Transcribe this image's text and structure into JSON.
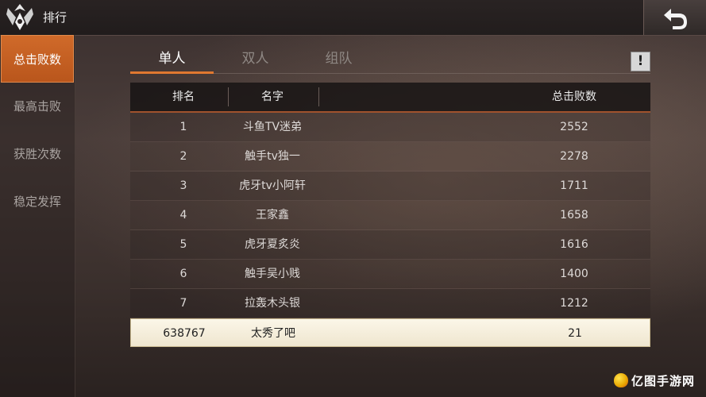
{
  "header": {
    "title": "排行"
  },
  "sidebar": {
    "items": [
      {
        "label": "总击败数",
        "active": true
      },
      {
        "label": "最高击败",
        "active": false
      },
      {
        "label": "获胜次数",
        "active": false
      },
      {
        "label": "稳定发挥",
        "active": false
      }
    ]
  },
  "tabs": [
    {
      "label": "单人",
      "active": true
    },
    {
      "label": "双人",
      "active": false
    },
    {
      "label": "组队",
      "active": false
    }
  ],
  "info_button": {
    "label": "!"
  },
  "table": {
    "headers": {
      "rank": "排名",
      "name": "名字",
      "score": "总击败数"
    },
    "rows": [
      {
        "rank": "1",
        "name": "斗鱼TV迷弟",
        "score": "2552"
      },
      {
        "rank": "2",
        "name": "触手tv独一",
        "score": "2278"
      },
      {
        "rank": "3",
        "name": "虎牙tv小阿轩",
        "score": "1711"
      },
      {
        "rank": "4",
        "name": "王家鑫",
        "score": "1658"
      },
      {
        "rank": "5",
        "name": "虎牙夏炙炎",
        "score": "1616"
      },
      {
        "rank": "6",
        "name": "触手吴小贱",
        "score": "1400"
      },
      {
        "rank": "7",
        "name": "拉轰木头银",
        "score": "1212"
      }
    ],
    "self_row": {
      "rank": "638767",
      "name": "太秀了吧",
      "score": "21"
    }
  },
  "watermark": {
    "text": "亿图手游网"
  },
  "colors": {
    "accent": "#d06a2a",
    "self_row_bg": "#fbf6e8",
    "header_bg": "#181414"
  },
  "icons": {
    "logo": "winged-emblem-icon",
    "back": "return-arrow-icon",
    "info": "exclamation-icon"
  }
}
